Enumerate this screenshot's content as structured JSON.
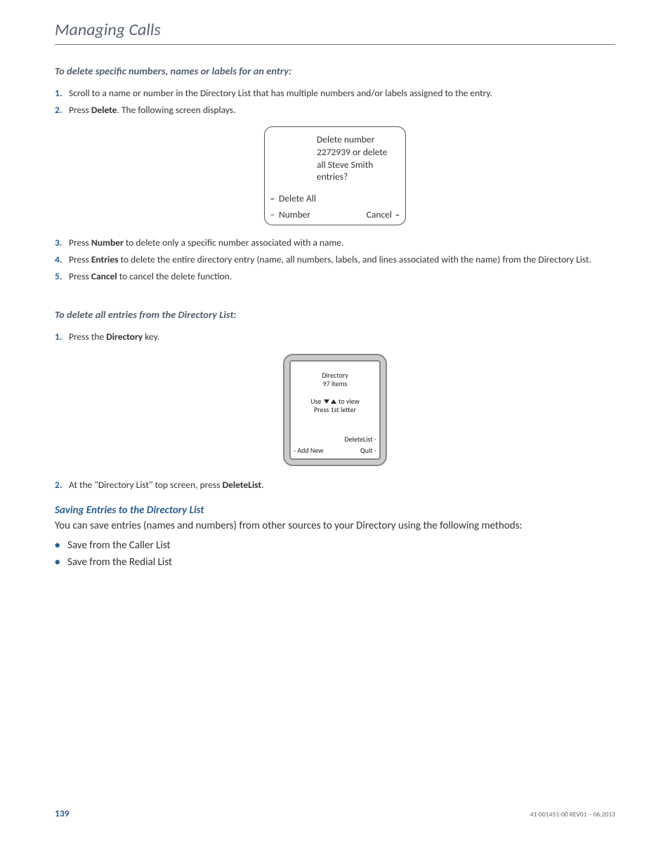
{
  "header": {
    "title": "Managing Calls"
  },
  "sectionA": {
    "heading": "To delete specific numbers, names or labels for an entry:",
    "steps": [
      {
        "num": "1.",
        "pre": "",
        "bold": "",
        "post": "Scroll to a name or number in the Directory List that has multiple numbers and/or labels assigned to the entry."
      },
      {
        "num": "2.",
        "pre": "Press ",
        "bold": "Delete",
        "post": ". The following screen displays."
      }
    ],
    "phone": {
      "line1": "Delete number",
      "line2": "2272939 or delete",
      "line3": "all Steve Smith",
      "line4": "entries?",
      "deleteAll": "Delete All",
      "number": "Number",
      "cancel": "Cancel"
    },
    "stepsAfter": [
      {
        "num": "3.",
        "pre": "Press ",
        "bold": "Number",
        "post": " to delete only a specific number associated with a name."
      },
      {
        "num": "4.",
        "pre": "Press ",
        "bold": "Entries",
        "post": " to delete the entire directory entry (name, all numbers, labels, and lines associated with the name) from the Directory List."
      },
      {
        "num": "5.",
        "pre": "Press ",
        "bold": "Cancel",
        "post": " to cancel the delete function."
      }
    ]
  },
  "sectionB": {
    "heading": "To delete all entries from the Directory List:",
    "steps": [
      {
        "num": "1.",
        "pre": "Press the ",
        "bold": "Directory",
        "post": " key."
      }
    ],
    "phone": {
      "title": "Directory",
      "count": "97 items",
      "usePre": "Use ",
      "usePost": " to view",
      "press": "Press 1st letter",
      "deleteList": "DeleteList -",
      "addNew": "- Add New",
      "quit": "Quit -"
    },
    "stepsAfter": [
      {
        "num": "2.",
        "pre": "At the \"Directory List\" top screen, press ",
        "bold": "DeleteList",
        "post": "."
      }
    ]
  },
  "sectionC": {
    "heading": "Saving Entries to the Directory List",
    "intro": "You can save entries (names and numbers) from other sources to your Directory using the following methods:",
    "bullets": [
      "Save from the Caller List",
      "Save from the Redial List"
    ]
  },
  "footer": {
    "pageNum": "139",
    "rev": "41-001451-00 REV01 – 06.2013"
  }
}
